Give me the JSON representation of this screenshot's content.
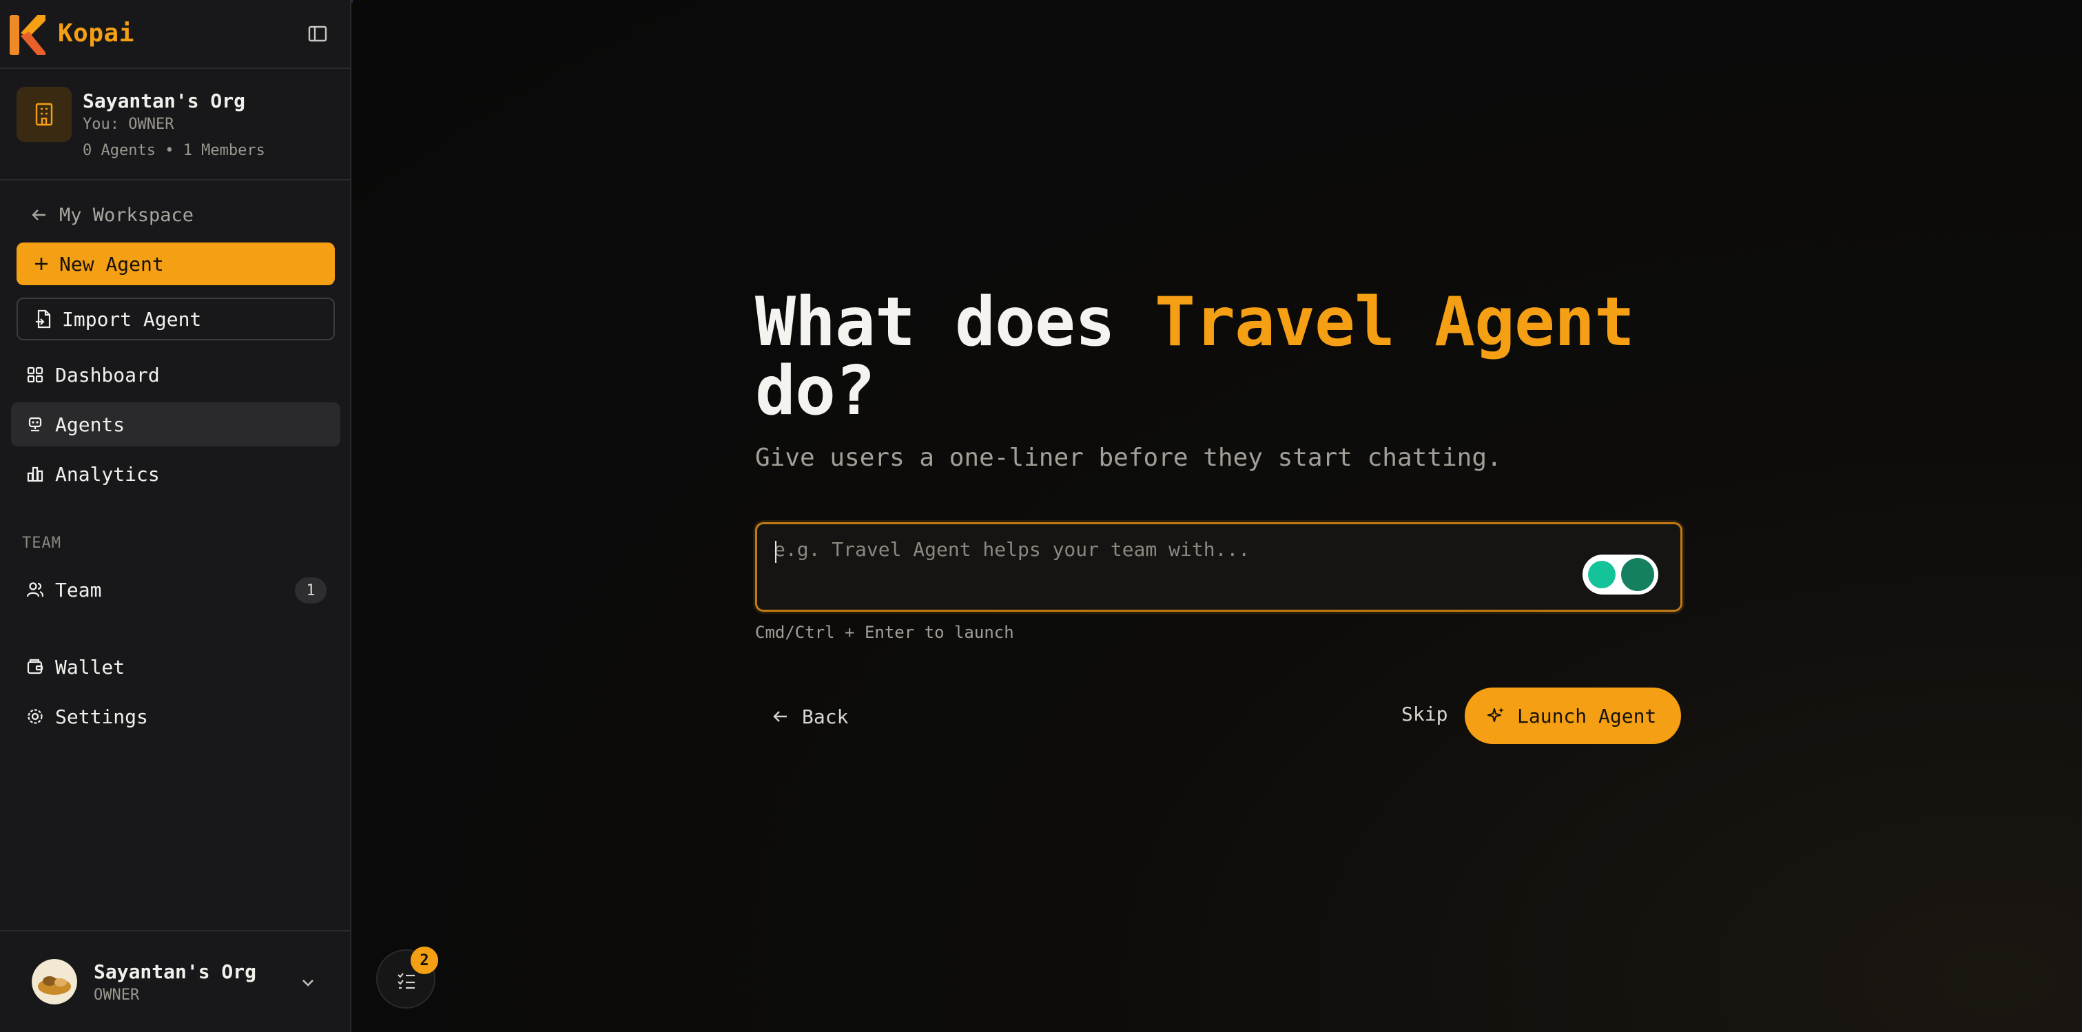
{
  "brand": {
    "name": "Kopai",
    "accent_color": "#f5a014"
  },
  "org": {
    "name": "Sayantan's Org",
    "role": "You: OWNER",
    "stats": "0 Agents • 1 Members"
  },
  "sidebar": {
    "back_label": "My Workspace",
    "new_agent_label": "New Agent",
    "import_agent_label": "Import Agent",
    "items": [
      {
        "label": "Dashboard",
        "icon": "grid-icon"
      },
      {
        "label": "Agents",
        "icon": "bot-icon",
        "active": true
      },
      {
        "label": "Analytics",
        "icon": "bar-chart-icon"
      }
    ],
    "section_team": "TEAM",
    "team": {
      "label": "Team",
      "count": "1",
      "icon": "users-icon"
    },
    "wallet": {
      "label": "Wallet",
      "icon": "wallet-icon"
    },
    "settings": {
      "label": "Settings",
      "icon": "gear-icon"
    }
  },
  "footer": {
    "name": "Sayantan's Org",
    "role": "OWNER"
  },
  "tasks": {
    "badge": "2"
  },
  "main": {
    "heading_prefix": "What does ",
    "heading_accent": "Travel Agent",
    "heading_suffix": "do?",
    "subtitle": "Give users a one-liner before they start chatting.",
    "input_placeholder": "e.g. Travel Agent helps your team with...",
    "hint": "Cmd/Ctrl + Enter to launch",
    "back_label": "Back",
    "skip_label": "Skip",
    "launch_label": "Launch Agent"
  }
}
